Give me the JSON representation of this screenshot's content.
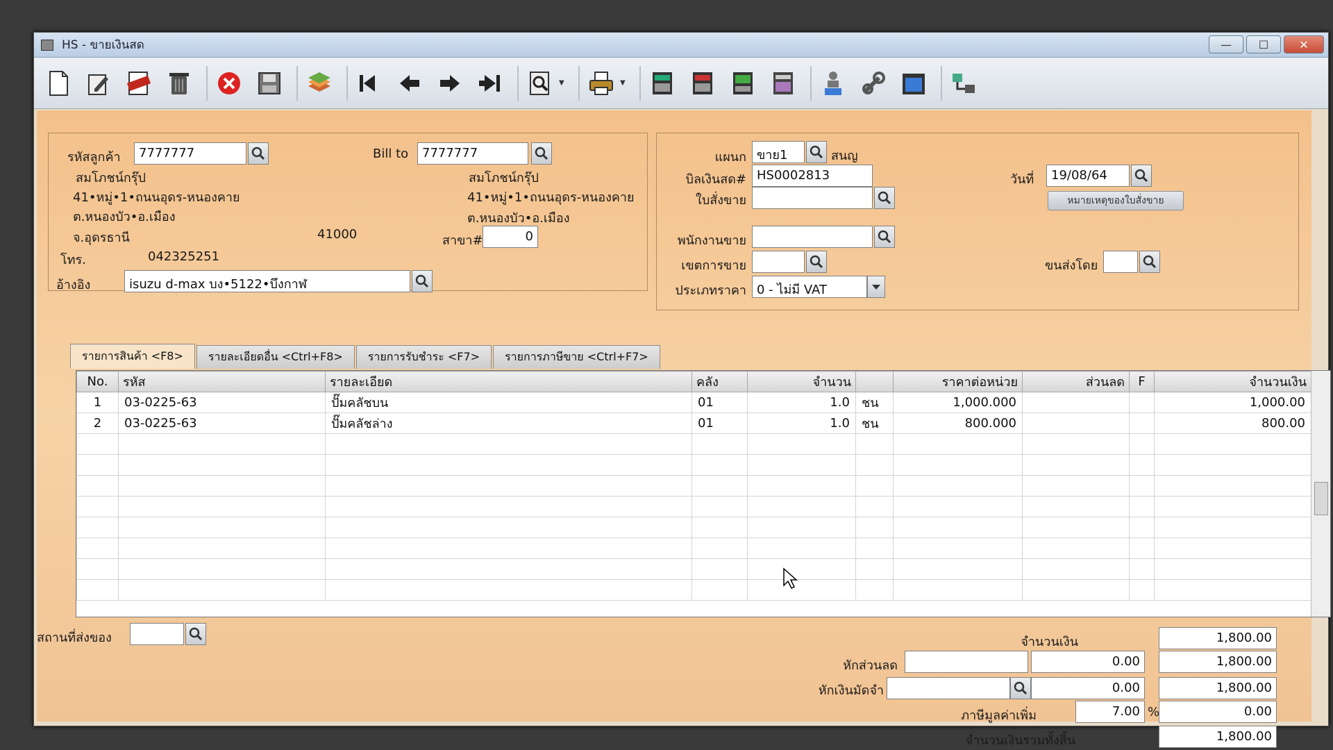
{
  "window": {
    "title": "HS - ขายเงินสด",
    "min": "—",
    "max": "☐",
    "close": "✕"
  },
  "toolbar": [
    "new-doc",
    "edit",
    "void",
    "delete",
    "cancel",
    "save",
    "stack",
    "first",
    "prev",
    "next",
    "last",
    "find",
    "print",
    "calc1",
    "calc2",
    "calc3",
    "calc4",
    "ok-person",
    "tools",
    "ok",
    "network"
  ],
  "customer": {
    "code_label": "รหัสลูกค้า",
    "code_value": "7777777",
    "name": "สมโภชน์กรุ๊ป",
    "addr1": "41•หมู่•1•ถนนอุดร-หนองคาย",
    "addr2": "ต.หนองบัว•อ.เมือง",
    "addr3": "จ.อุดรธานี",
    "zip": "41000",
    "phone_label": "โทร.",
    "phone_value": "042325251",
    "ref_label": "อ้างอิง",
    "ref_value": "isuzu d-max บง•5122•บึงกาฬ"
  },
  "billto": {
    "label": "Bill to",
    "value": "7777777",
    "name": "สมโภชน์กรุ๊ป",
    "addr1": "41•หมู่•1•ถนนอุดร-หนองคาย",
    "addr2": "ต.หนองบัว•อ.เมือง",
    "branch_label": "สาขา#",
    "branch_value": "0"
  },
  "doc": {
    "dept_label": "แผนก",
    "dept_value": "ขาย1",
    "dept_name": "สนญ",
    "bill_label": "บิลเงินสด#",
    "bill_value": "HS0002813",
    "so_label": "ใบสั่งขาย",
    "so_value": "",
    "date_label": "วันที่",
    "date_value": "19/08/64",
    "note_button": "หมายเหตุของใบสั่งขาย",
    "salesman_label": "พนักงานขาย",
    "salesman_value": "",
    "area_label": "เขตการขาย",
    "area_value": "",
    "ship_label": "ขนส่งโดย",
    "ship_value": "",
    "price_label": "ประเภทราคา",
    "price_value": "0 - ไม่มี VAT"
  },
  "tabs": [
    "รายการสินค้า <F8>",
    "รายละเอียดอื่น <Ctrl+F8>",
    "รายการรับชำระ <F7>",
    "รายการภาษีขาย <Ctrl+F7>"
  ],
  "grid": {
    "headers": [
      "No.",
      "รหัส",
      "รายละเอียด",
      "คลัง",
      "จำนวน",
      "",
      "ราคาต่อหน่วย",
      "ส่วนลด",
      "F",
      "จำนวนเงิน"
    ],
    "rows": [
      [
        "1",
        "03-0225-63",
        "ปั๊มคลัชบน",
        "01",
        "1.0",
        "ชน",
        "1,000.000",
        "",
        "",
        "1,000.00"
      ],
      [
        "2",
        "03-0225-63",
        "ปั๊มคลัชล่าง",
        "01",
        "1.0",
        "ชน",
        "800.000",
        "",
        "",
        "800.00"
      ]
    ]
  },
  "footer": {
    "place_label": "สถานที่ส่งของ",
    "place_value": "",
    "amount_label": "จำนวนเงิน",
    "amount_value": "1,800.00",
    "disc_label": "หักส่วนลด",
    "disc_text": "",
    "disc_value": "0.00",
    "disc_total": "1,800.00",
    "deposit_label": "หักเงินมัดจำ",
    "deposit_text": "",
    "deposit_value": "0.00",
    "deposit_total": "1,800.00",
    "vat_label": "ภาษีมูลค่าเพิ่ม",
    "vat_rate": "7.00",
    "vat_pct": "%",
    "vat_value": "0.00",
    "grand_label": "จำนวนเงินรวมทั้งสิ้น",
    "grand_value": "1,800.00"
  }
}
